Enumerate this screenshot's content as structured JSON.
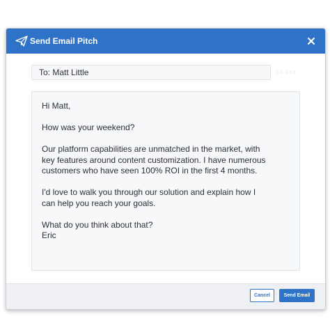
{
  "dialog": {
    "title": "Send Email Pitch",
    "header_icon": "paper-plane-icon",
    "close_icon": "close-icon",
    "accent_color": "#2f73c8"
  },
  "recipient": {
    "value": "To: Matt Little",
    "cc_hint": "cc bcc"
  },
  "message": {
    "greeting": "Hi Matt,",
    "line1": "How was your weekend?",
    "paragraph1": "Our platform capabilities are unmatched in the market, with\nkey features around content customization. I have numerous\ncustomers who have seen 100% ROI in the first 4 months.",
    "paragraph2": "I'd love to walk you through our solution and explain how I\ncan help you reach your goals.",
    "closing": "What do you think about that?\nEric"
  },
  "footer": {
    "cancel_label": "Cancel",
    "send_label": "Send Email"
  }
}
